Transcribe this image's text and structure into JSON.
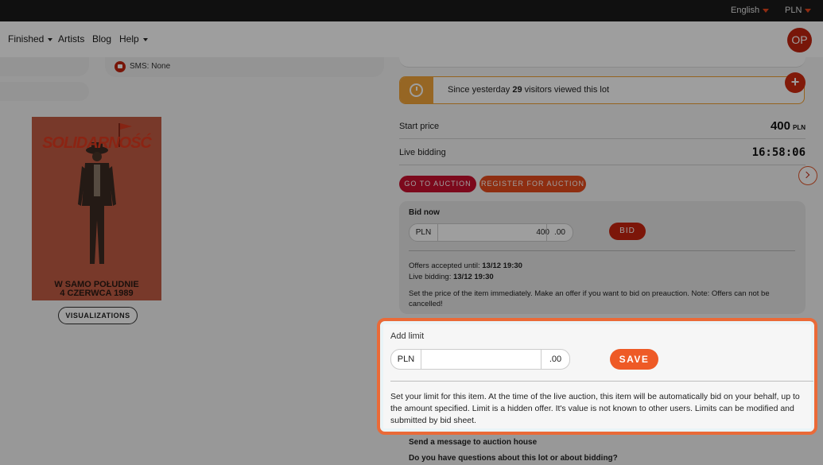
{
  "topbar": {
    "language": "English",
    "currency": "PLN"
  },
  "nav": {
    "finished": "Finished",
    "artists": "Artists",
    "blog": "Blog",
    "help": "Help",
    "avatar_initials": "OP"
  },
  "contact": {
    "sms": "SMS: None"
  },
  "poster": {
    "title": "SOLIDARNOŚĆ",
    "line1": "W SAMO POŁUDNIE",
    "line2": "4 CZERWCA 1989"
  },
  "visualizations_label": "VISUALIZATIONS",
  "visitors": {
    "prefix": "Since yesterday ",
    "count": "29",
    "suffix": " visitors viewed this lot"
  },
  "price": {
    "start_label": "Start price",
    "start_value": "400",
    "start_currency": "PLN",
    "live_label": "Live bidding",
    "live_time": "16:58:06"
  },
  "actions": {
    "go_to_auction": "GO TO AUCTION",
    "register": "REGISTER FOR AUCTION"
  },
  "bid": {
    "title": "Bid now",
    "currency": "PLN",
    "amount": "400",
    "decimals": ".00",
    "button": "BID",
    "offers_label": "Offers accepted until: ",
    "offers_value": "13/12 19:30",
    "live_label": "Live bidding: ",
    "live_value": "13/12 19:30",
    "note": "Set the price of the item immediately. Make an offer if you want to bid on preauction. Note: Offers can not be cancelled!"
  },
  "limit": {
    "title": "Add limit",
    "currency": "PLN",
    "amount": "",
    "decimals": ".00",
    "save": "SAVE",
    "description": "Set your limit for this item. At the time of the live auction, this item will be automatically bid on your behalf, up to the amount specified. Limit is a hidden offer. It's value is not known to other users. Limits can be modified and submitted by bid sheet."
  },
  "message": {
    "title": "Send a message to auction house",
    "question": "Do you have questions about this lot or about bidding?"
  },
  "colors": {
    "accent_red": "#c8102e",
    "accent_orange": "#e54b1c",
    "highlight_border": "#ea6a38"
  }
}
